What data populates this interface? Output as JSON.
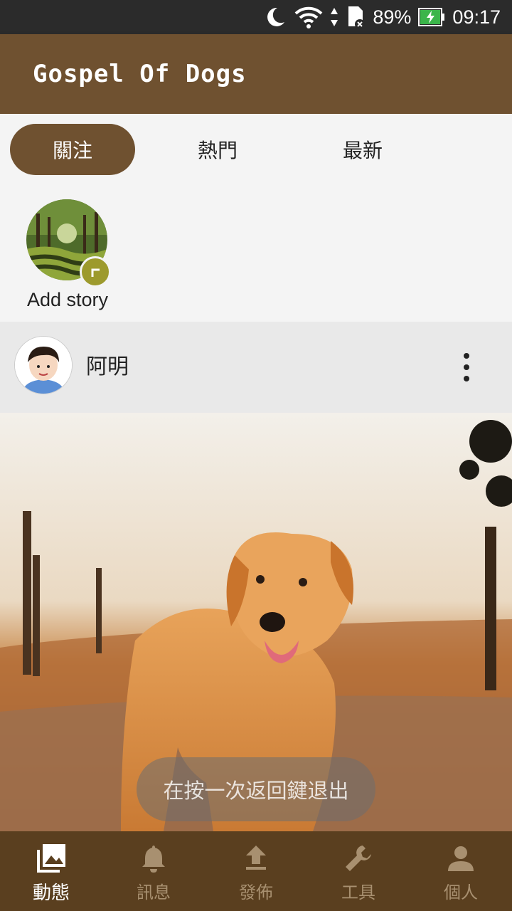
{
  "status_bar": {
    "battery": "89%",
    "time": "09:17"
  },
  "app_bar": {
    "title": "Gospel Of Dogs"
  },
  "tabs": [
    {
      "label": "關注",
      "active": true
    },
    {
      "label": "熱門",
      "active": false
    },
    {
      "label": "最新",
      "active": false
    }
  ],
  "stories": {
    "add_label": "Add story"
  },
  "post": {
    "username": "阿明"
  },
  "toast": {
    "text": "在按一次返回鍵退出"
  },
  "bottom_nav": [
    {
      "label": "動態",
      "icon": "photo-library-icon",
      "active": true
    },
    {
      "label": "訊息",
      "icon": "bell-icon",
      "active": false
    },
    {
      "label": "發佈",
      "icon": "upload-icon",
      "active": false
    },
    {
      "label": "工具",
      "icon": "wrench-icon",
      "active": false
    },
    {
      "label": "個人",
      "icon": "person-icon",
      "active": false
    }
  ],
  "colors": {
    "brand": "#6f5130",
    "nav_bg": "#5a3f1f",
    "status_bar": "#2b2b2b",
    "story_badge": "#9d9a2d"
  }
}
